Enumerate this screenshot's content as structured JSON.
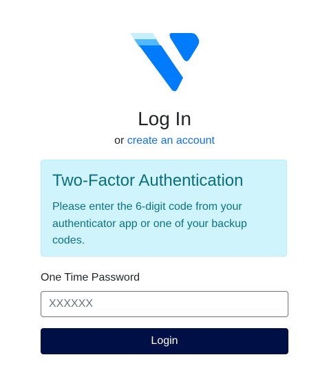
{
  "brand": {
    "logo_icon": "vultr-logo-icon",
    "colors": {
      "logo_light": "#c6eefc",
      "logo_mid": "#51b9ff",
      "logo_dark": "#007bfc"
    }
  },
  "header": {
    "title": "Log In",
    "or_text": "or ",
    "create_account_link": "create an account"
  },
  "alert": {
    "heading": "Two-Factor Authentication",
    "body": "Please enter the 6-digit code from your authenticator app or one of your backup codes.",
    "background": "#cff4fc"
  },
  "form": {
    "otp_label": "One Time Password",
    "otp_value": "",
    "otp_placeholder": "XXXXXX",
    "login_button": "Login",
    "login_button_color": "#001046"
  }
}
